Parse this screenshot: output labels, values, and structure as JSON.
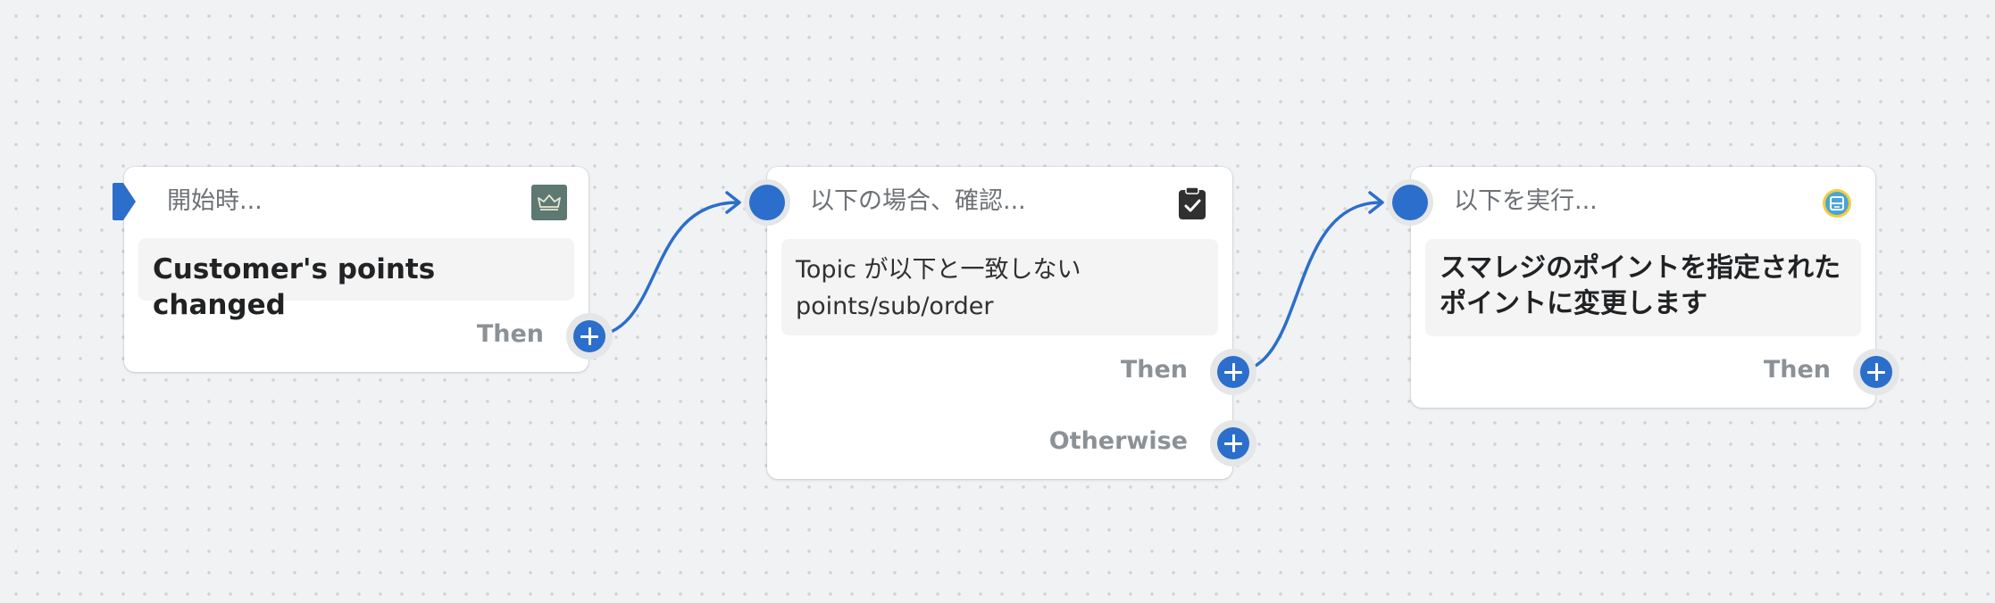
{
  "colors": {
    "accent": "#2c6ecb",
    "canvas": "#f1f2f4",
    "trigger_icon_bg": "#5e7872",
    "title_text": "#6d7175",
    "content_text": "#202223",
    "branch_label": "#8c9196"
  },
  "nodes": {
    "trigger": {
      "title": "開始時...",
      "icon": "crown-icon",
      "content": "Customer's points changed",
      "outputs": {
        "then": "Then"
      }
    },
    "condition": {
      "title": "以下の場合、確認...",
      "icon": "clipboard-check-icon",
      "content_lines": [
        "Topic が以下と一致しない",
        "points/sub/order"
      ],
      "outputs": {
        "then": "Then",
        "otherwise": "Otherwise"
      }
    },
    "action": {
      "title": "以下を実行...",
      "icon": "smaregi-app-icon",
      "content": "スマレジのポイントを指定されたポイントに変更します",
      "outputs": {
        "then": "Then"
      }
    }
  }
}
